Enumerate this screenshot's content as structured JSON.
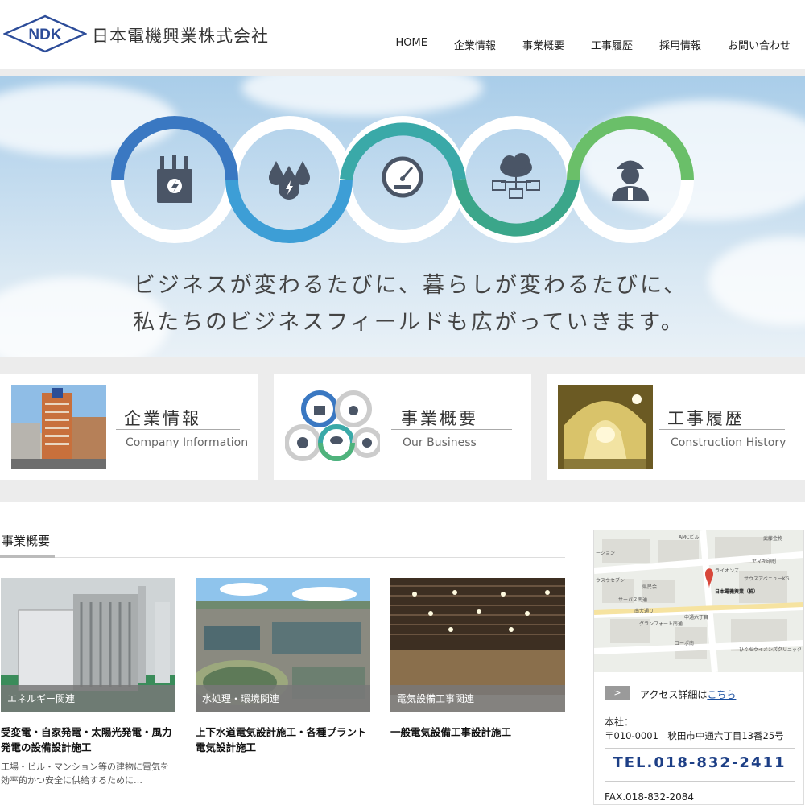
{
  "header": {
    "logo_text": "NDK",
    "company_name": "日本電機興業株式会社",
    "nav": [
      "HOME",
      "企業情報",
      "事業概要",
      "工事履歴",
      "採用情報",
      "お問い合わせ"
    ]
  },
  "hero": {
    "tagline_line1": "ビジネスが変わるたびに、暮らしが変わるたびに、",
    "tagline_line2": "私たちのビジネスフィールドも広がっていきます。",
    "icons": [
      "transformer-icon",
      "water-drops-icon",
      "gauge-icon",
      "cloud-network-icon",
      "worker-icon"
    ],
    "ring_colors": [
      "#3a78c2",
      "#3d9ed6",
      "#3aa9a8",
      "#3ba68a",
      "#6abf69"
    ]
  },
  "cards": [
    {
      "title": "企業情報",
      "subtitle": "Company Information"
    },
    {
      "title": "事業概要",
      "subtitle": "Our Business"
    },
    {
      "title": "工事履歴",
      "subtitle": "Construction History"
    }
  ],
  "business": {
    "section_title": "事業概要",
    "items": [
      {
        "category": "エネルギー関連",
        "headline": "受変電・自家発電・太陽光発電・風力発電の設備設計施工",
        "desc": "工場・ビル・マンション等の建物に電気を効率的かつ安全に供給するために…"
      },
      {
        "category": "水処理・環境関連",
        "headline": "上下水道電気設計施工・各種プラント電気設計施工",
        "desc": ""
      },
      {
        "category": "電気設備工事関連",
        "headline": "一般電気設備工事設計施工",
        "desc": ""
      }
    ]
  },
  "sidebar": {
    "access_button": ">",
    "access_text": "アクセス詳細は",
    "access_link": "こちら",
    "hq_label": "本社：",
    "hq_address": "〒010-0001　秋田市中通六丁目13番25号",
    "tel": "TEL.018-832-2411",
    "fax": "FAX.018-832-2084",
    "map_labels": [
      "AMCビル",
      "武藤金物",
      "ヤマキ印刷",
      "ライオンズ",
      "サウスアベニューKG",
      "日本電機興業（株）",
      "南大通り",
      "サーパス南通",
      "グランフォート南通",
      "中通六丁目",
      "コーポ南",
      "ひぐちウイメンズクリニック",
      "ウスウセブン",
      "ーション",
      "県民会"
    ]
  }
}
